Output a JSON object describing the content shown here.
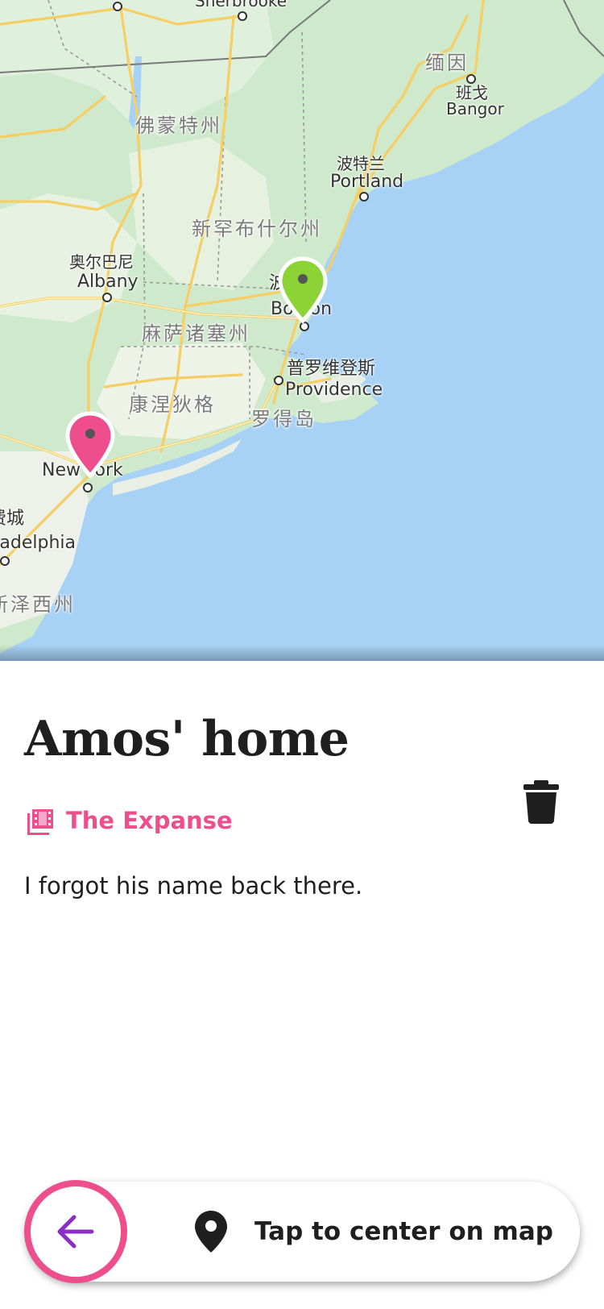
{
  "map": {
    "labels": {
      "sherbrooke": "Sherbrooke",
      "maine": "缅因",
      "bangor_cn": "班戈",
      "bangor": "Bangor",
      "vermont": "佛蒙特州",
      "portland_cn": "波特兰",
      "portland": "Portland",
      "new_hampshire": "新罕布什尔州",
      "albany_cn": "奥尔巴尼",
      "albany": "Albany",
      "boston_cn": "波士顿",
      "boston": "Boston",
      "massachusetts": "麻萨诸塞州",
      "providence_cn": "普罗维登斯",
      "providence": "Providence",
      "connecticut": "康涅狄格",
      "rhode_island": "罗得岛",
      "new_york": "New York",
      "philadelphia_cn": "费城",
      "philadelphia": "Philadelphia",
      "new_jersey": "新泽西州"
    },
    "pins": [
      {
        "name": "boston-pin",
        "color": "#8cd436"
      },
      {
        "name": "new-york-pin",
        "color": "#ef4e8d"
      }
    ],
    "colors": {
      "water": "#aad3df",
      "land": "#c9e7c7",
      "road": "#f7d46b"
    }
  },
  "place": {
    "title": "Amos' home",
    "category": "The Expanse",
    "note": "I forgot his name back there."
  },
  "bottom_bar": {
    "center_label": "Tap to center on map"
  },
  "colors": {
    "accent": "#ef4e8d",
    "back_arrow": "#8b2ec4"
  }
}
